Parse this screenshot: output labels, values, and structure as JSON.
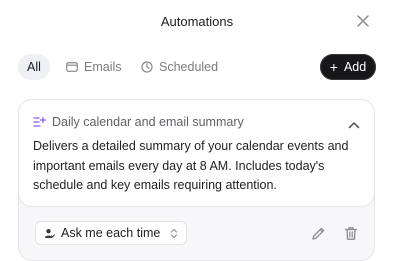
{
  "header": {
    "title": "Automations",
    "close_icon": "close-icon"
  },
  "tabs": [
    {
      "label": "All",
      "icon": "",
      "active": true
    },
    {
      "label": "Emails",
      "icon": "mail-icon",
      "active": false
    },
    {
      "label": "Scheduled",
      "icon": "clock-icon",
      "active": false
    }
  ],
  "add_button": {
    "label": "Add",
    "icon": "plus-icon"
  },
  "automation": {
    "title": "Daily calendar and email summary",
    "icon": "sparkle-list-icon",
    "description": "Delivers a detailed summary of your calendar events and important emails every day at 8 AM. Includes today's schedule and key emails requiring attention.",
    "approval_select": {
      "value": "Ask me each time",
      "icon": "user-check-icon"
    },
    "actions": {
      "edit_icon": "pencil-icon",
      "delete_icon": "trash-icon"
    }
  },
  "colors": {
    "accent_purple": "#8b5cf6",
    "button_dark": "#17171a",
    "tab_active_bg": "#eef0f4"
  }
}
